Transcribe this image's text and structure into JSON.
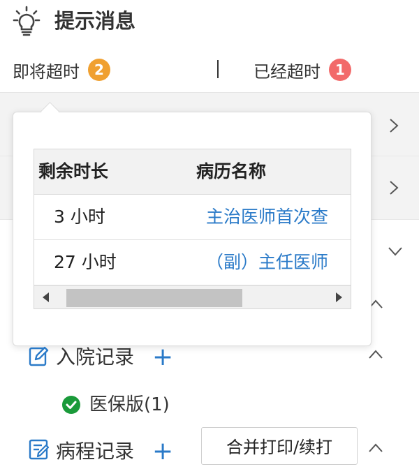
{
  "header": {
    "title": "提示消息",
    "icon": "lightbulb-icon"
  },
  "tabs": [
    {
      "label": "即将超时",
      "count": "2",
      "badge_color": "#f0a030"
    },
    {
      "label": "已经超时",
      "count": "1",
      "badge_color": "#f26a6a"
    }
  ],
  "separator": "|",
  "popover": {
    "columns": [
      "剩余时长",
      "病历名称"
    ],
    "rows": [
      {
        "duration": "3 小时",
        "record": "主治医师首次查"
      },
      {
        "duration": "27 小时",
        "record": "（副）主任医师"
      }
    ]
  },
  "sections": [
    {
      "label": "入院记录",
      "plus": "+",
      "icon": "edit-record-icon"
    },
    {
      "label": "病程记录",
      "plus": "+",
      "icon": "edit-list-icon"
    }
  ],
  "subitem": {
    "label": "医保版(1)",
    "status_color": "#1a9a3a"
  },
  "print_button": {
    "label": "合并打印/续打"
  },
  "colors": {
    "link": "#2a7ac8",
    "accent": "#2a7ac8"
  }
}
